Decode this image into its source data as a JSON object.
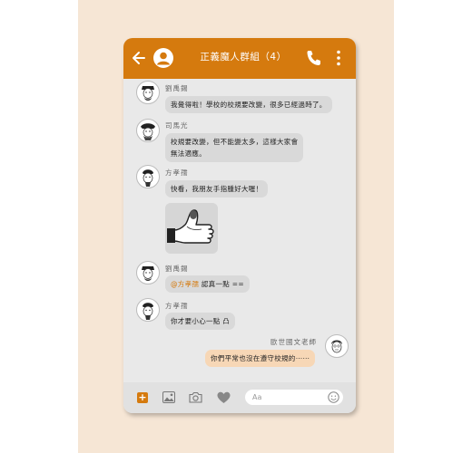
{
  "header": {
    "title": "正義魔人群組（4）"
  },
  "messages": [
    {
      "sender": "劉禹錫",
      "text": "我覺得啦！學校的校規要改變，很多已經過時了。"
    },
    {
      "sender": "司馬光",
      "lines": [
        "校規要改變，但不能變太多，這樣大家會",
        "無法適應。"
      ]
    },
    {
      "sender": "方孝孺",
      "text": "快看，我朋友手指腫好大喔！"
    },
    {
      "sender": "劉禹錫",
      "mention": "@方孝孺",
      "text": " 認真一點 =="
    },
    {
      "sender": "方孝孺",
      "text": "你才要小心一點 凸"
    },
    {
      "sender": "歐世國文老師",
      "text": "你們平常也沒在遵守校規的⋯⋯",
      "is_me": true
    }
  ],
  "composer": {
    "placeholder": "Aa"
  },
  "colors": {
    "accent": "#d57a0e",
    "my_bubble": "#f7d7b6",
    "bubble": "#d9d9d9",
    "background": "#f6e6d5"
  },
  "icons": [
    "back-arrow-icon",
    "profile-icon",
    "phone-icon",
    "more-vertical-icon",
    "plus-icon",
    "image-icon",
    "camera-icon",
    "heart-icon",
    "smile-icon"
  ]
}
